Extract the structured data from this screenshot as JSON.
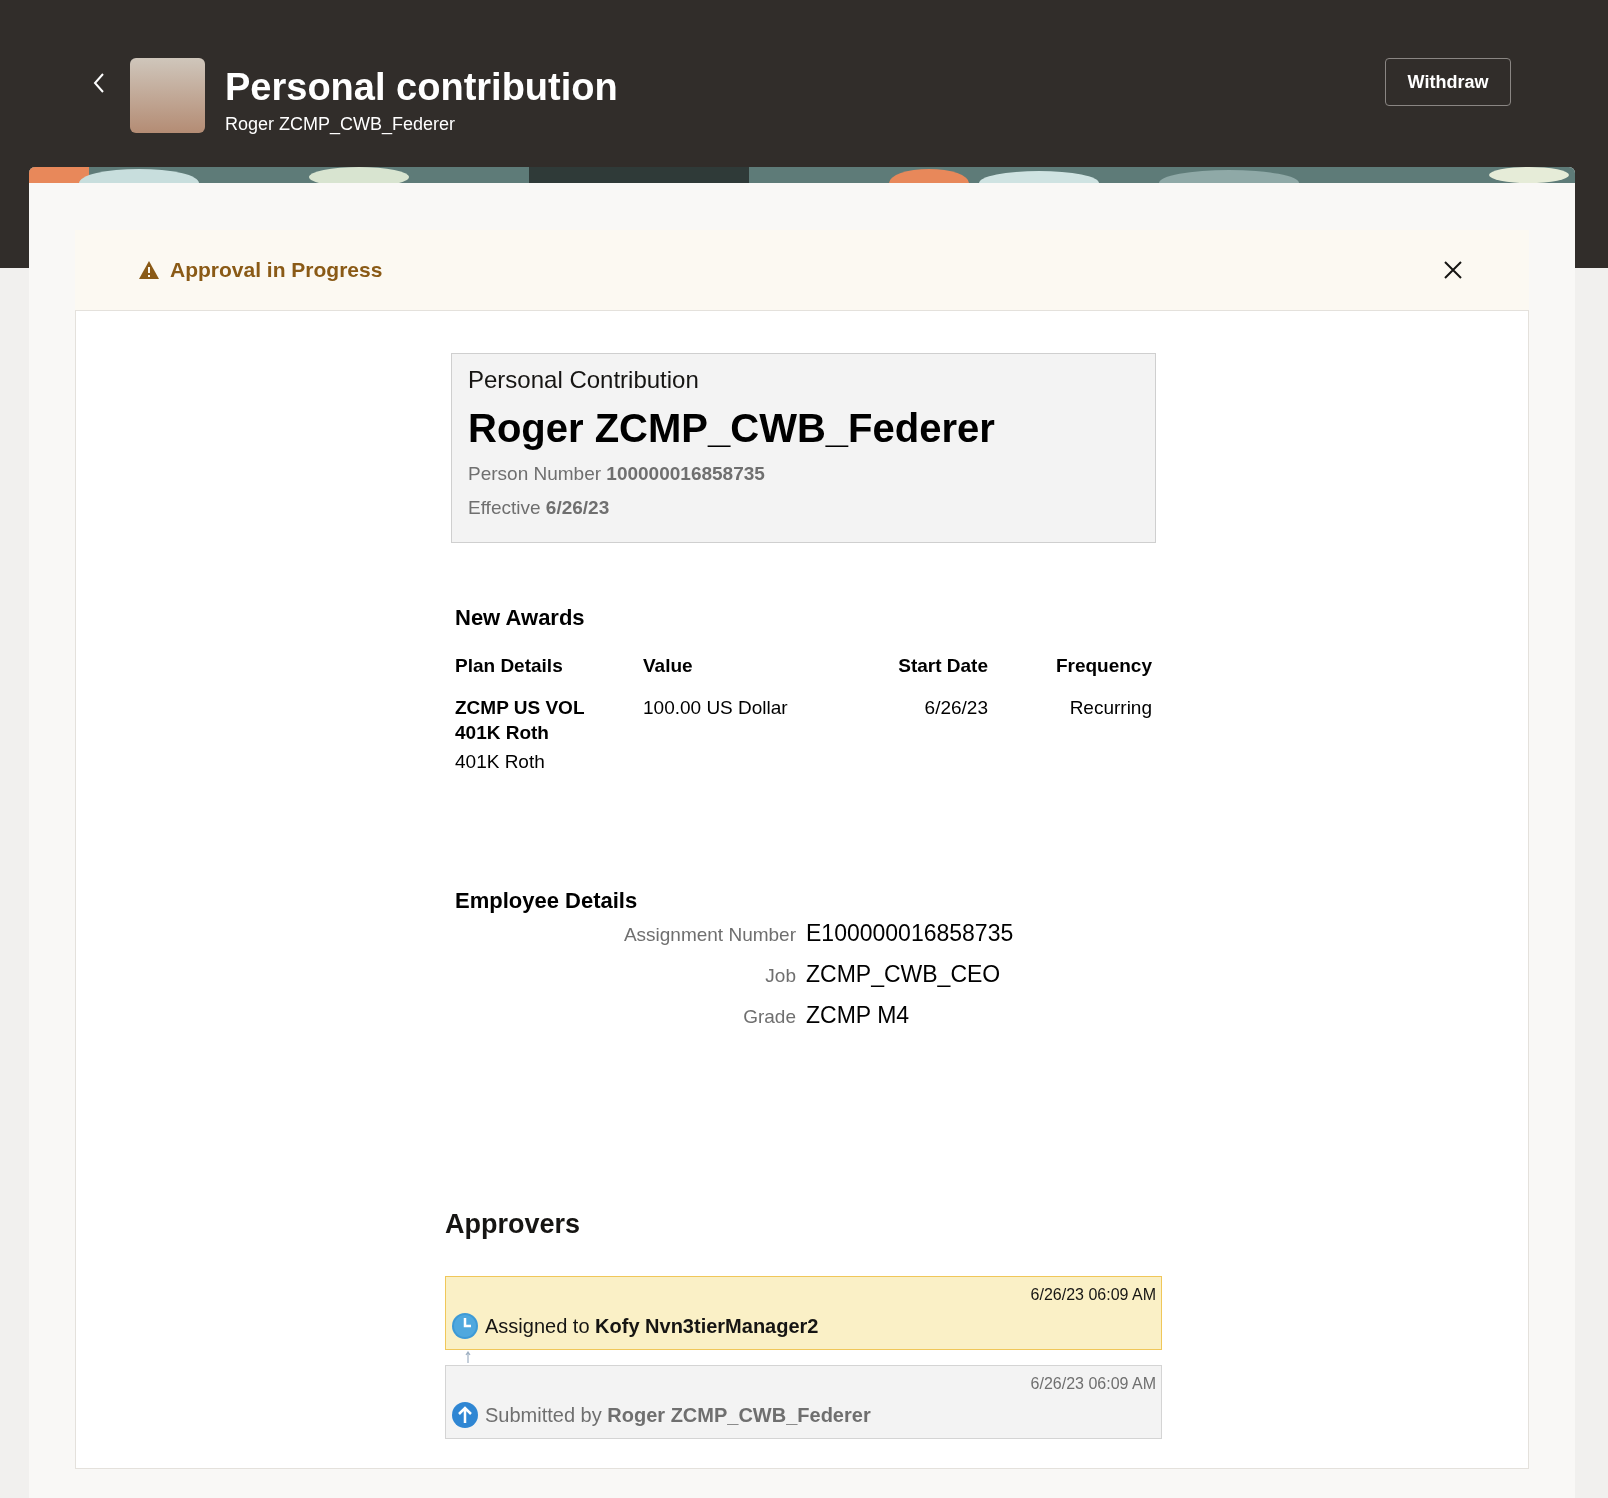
{
  "header": {
    "title": "Personal contribution",
    "subtitle": "Roger ZCMP_CWB_Federer",
    "button": "Withdraw"
  },
  "alert": {
    "message": "Approval in Progress"
  },
  "summary": {
    "heading": "Personal Contribution",
    "name": "Roger ZCMP_CWB_Federer",
    "lines": [
      "Person Number **100000016858735**",
      "Effective **6/26/23**"
    ]
  },
  "awards": {
    "title": "New Awards",
    "columns": [
      "Plan Details",
      "Value",
      "Start Date",
      "Frequency"
    ],
    "rows": [
      {
        "plan": "ZCMP US VOL 401K Roth",
        "plan_sub": "401K Roth",
        "value": "100.00 US Dollar",
        "start_date": "6/26/23",
        "frequency": "Recurring"
      }
    ]
  },
  "employee": {
    "title": "Employee Details",
    "fields": [
      {
        "label": "Assignment Number",
        "value": "E100000016858735"
      },
      {
        "label": "Job",
        "value": "ZCMP_CWB_CEO"
      },
      {
        "label": "Grade",
        "value": "ZCMP M4"
      }
    ]
  },
  "approvers": {
    "title": "Approvers",
    "items": [
      {
        "kind": "pending",
        "time": "6/26/23 06:09 AM",
        "text": "Assigned to **Kofy Nvn3tierManager2**"
      },
      {
        "kind": "submitted",
        "time": "6/26/23 06:09 AM",
        "text": "Submitted by **Roger ZCMP_CWB_Federer**"
      }
    ]
  }
}
